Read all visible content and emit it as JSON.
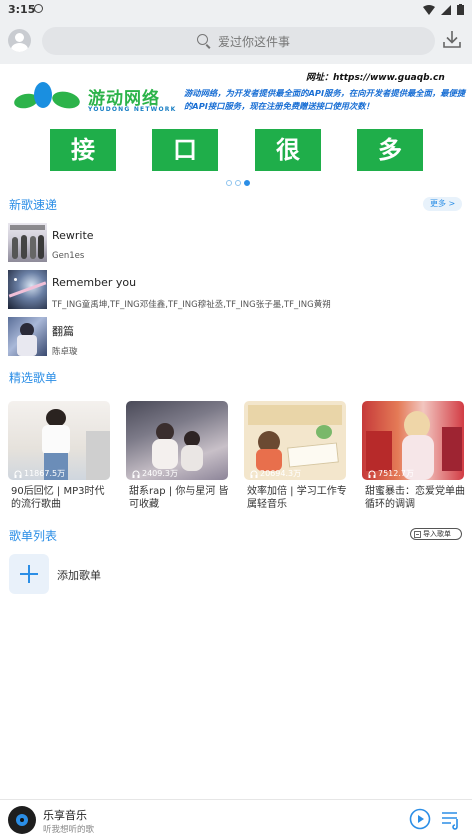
{
  "status": {
    "time": "3:15"
  },
  "header": {
    "search_placeholder": "爱过你这件事"
  },
  "banner": {
    "brand": "游动网络",
    "brand_en": "YOUDONG NETWORK",
    "site": "网址：https://www.guaqb.cn",
    "description": "游动网络，为开发者提供最全面的API服务，在向开发者提供最全面，最便捷的API接口服务，现在注册免费赠送接口使用次数！",
    "chars": [
      "接",
      "口",
      "很",
      "多"
    ]
  },
  "new_songs": {
    "title": "新歌速递",
    "more_label": "更多 >",
    "items": [
      {
        "title": "Rewrite",
        "artist": "Gen1es"
      },
      {
        "title": "Remember you",
        "artist": "TF_ING童禹坤,TF_ING邓佳鑫,TF_ING穆祉丞,TF_ING张子墨,TF_ING黄朔"
      },
      {
        "title": "翻篇",
        "artist": "陈卓璇"
      }
    ]
  },
  "featured": {
    "title": "精选歌单",
    "items": [
      {
        "count": "11867.5万",
        "title": "90后回忆 | MP3时代的流行歌曲"
      },
      {
        "count": "2409.3万",
        "title": "甜系rap | 你与星河 皆可收藏"
      },
      {
        "count": "20694.3万",
        "title": "效率加倍 | 学习工作专属轻音乐"
      },
      {
        "count": "7512.7万",
        "title": "甜蜜暴击：恋爱党单曲循环的调调"
      }
    ]
  },
  "playlists": {
    "title": "歌单列表",
    "import_label": "导入歌单",
    "add_label": "添加歌单"
  },
  "player": {
    "name": "乐享音乐",
    "subtitle": "听我想听的歌"
  },
  "colors": {
    "accent": "#2b8ee6",
    "banner_green": "#1fae4a"
  }
}
